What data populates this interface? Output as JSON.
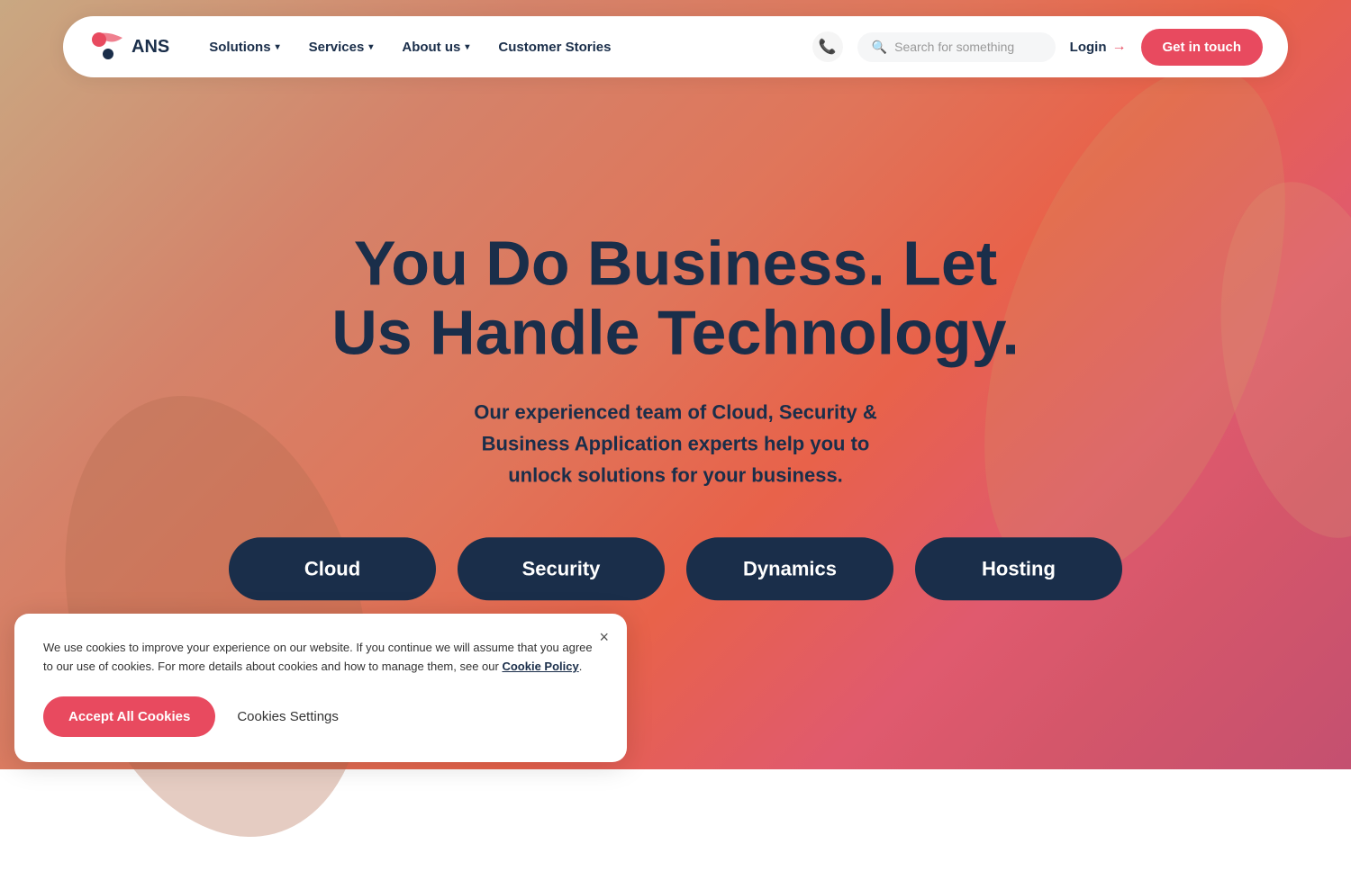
{
  "brand": {
    "name": "ANS",
    "logo_alt": "ANS Logo"
  },
  "header": {
    "nav": [
      {
        "label": "Solutions",
        "has_dropdown": true
      },
      {
        "label": "Services",
        "has_dropdown": true
      },
      {
        "label": "About us",
        "has_dropdown": true
      },
      {
        "label": "Customer Stories",
        "has_dropdown": false
      }
    ],
    "search_placeholder": "Search for something",
    "login_label": "Login",
    "get_in_touch_label": "Get in touch"
  },
  "hero": {
    "title_line1": "You Do Business. Let",
    "title_line2": "Us Handle Technology.",
    "subtitle": "Our experienced team of Cloud, Security &\nBusiness Application experts help you to\nunlock solutions for your business.",
    "buttons": [
      {
        "label": "Cloud"
      },
      {
        "label": "Security"
      },
      {
        "label": "Dynamics"
      },
      {
        "label": "Hosting"
      }
    ]
  },
  "cookie_banner": {
    "message": "We use cookies to improve your experience on our website. If you continue we will assume that you agree to our use of cookies. For more details about cookies and how to manage them, see our",
    "link_text": "Cookie Policy",
    "accept_label": "Accept All Cookies",
    "settings_label": "Cookies Settings",
    "close_label": "×"
  },
  "colors": {
    "accent": "#e84a5f",
    "dark_navy": "#1a2e4a"
  }
}
